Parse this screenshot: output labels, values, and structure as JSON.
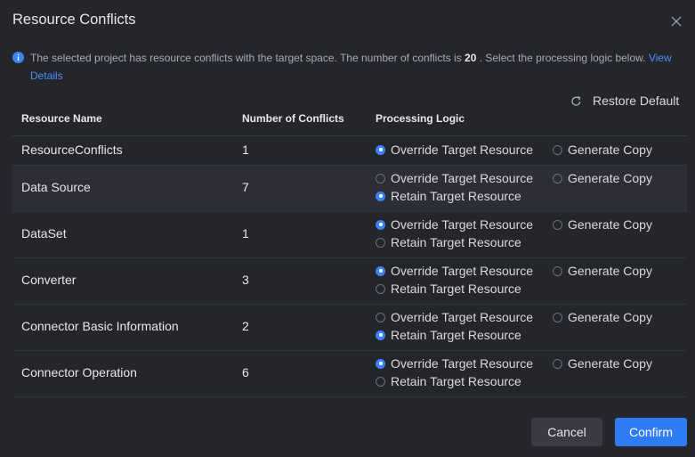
{
  "dialog": {
    "title": "Resource Conflicts",
    "info": {
      "before": "The selected project has resource conflicts with the target space. The number of conflicts is ",
      "count": "20",
      "after": " . Select the processing logic below. ",
      "link": "View Details"
    },
    "restore_label": "Restore Default",
    "columns": {
      "name": "Resource Name",
      "count": "Number of Conflicts",
      "logic": "Processing Logic"
    },
    "options": {
      "override": "Override Target Resource",
      "copy": "Generate Copy",
      "retain": "Retain Target Resource"
    },
    "rows": [
      {
        "name": "ResourceConflicts",
        "count": "1",
        "selected": "override",
        "has_retain": false
      },
      {
        "name": "Data Source",
        "count": "7",
        "selected": "retain",
        "has_retain": true
      },
      {
        "name": "DataSet",
        "count": "1",
        "selected": "override",
        "has_retain": true
      },
      {
        "name": "Converter",
        "count": "3",
        "selected": "override",
        "has_retain": true
      },
      {
        "name": "Connector Basic Information",
        "count": "2",
        "selected": "retain",
        "has_retain": true
      },
      {
        "name": "Connector Operation",
        "count": "6",
        "selected": "override",
        "has_retain": true
      }
    ],
    "cancel_label": "Cancel",
    "confirm_label": "Confirm"
  },
  "icons": {
    "close": "close-icon",
    "info": "info-icon",
    "restore": "refresh-icon"
  },
  "colors": {
    "accent": "#2f7cf6",
    "link": "#4a8ef5",
    "background": "#25262c"
  }
}
